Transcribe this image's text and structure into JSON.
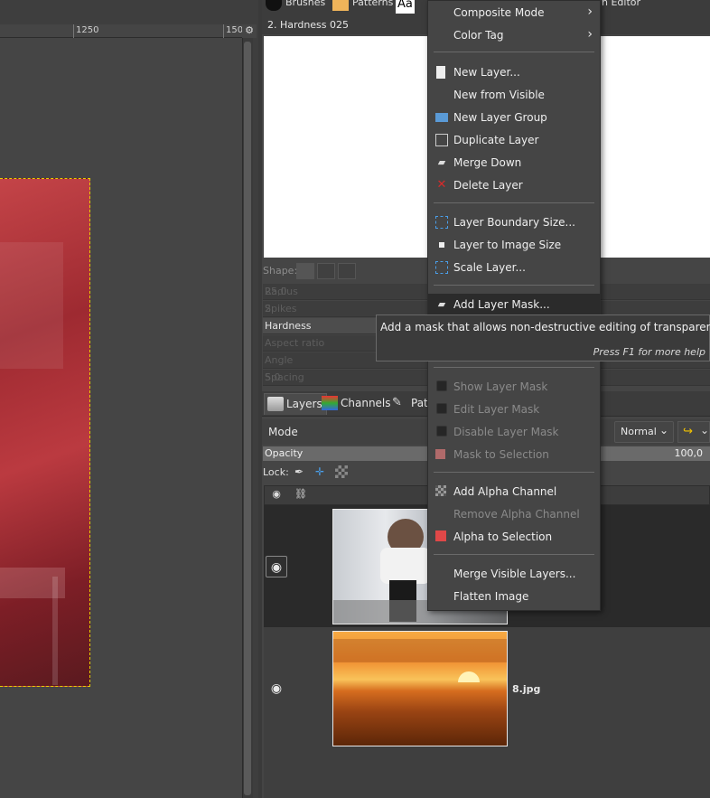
{
  "canvas": {
    "ruler_labels": [
      "1250",
      "150"
    ]
  },
  "top_tabs": {
    "brushes": "Brushes",
    "patterns": "Patterns",
    "fonts_icon_text": "Aa",
    "editor": "n Editor"
  },
  "brush_panel": {
    "title": "2. Hardness 025",
    "shape_label": "Shape:",
    "params": [
      {
        "label": "Radius",
        "value": "25,0"
      },
      {
        "label": "Spikes",
        "value": "2"
      },
      {
        "label": "Hardness",
        "value": ""
      },
      {
        "label": "Aspect ratio",
        "value": ""
      },
      {
        "label": "Angle",
        "value": ""
      },
      {
        "label": "Spacing",
        "value": "5,0"
      }
    ]
  },
  "dock": {
    "tabs": [
      {
        "label": "Layers",
        "icon": "layers-icon"
      },
      {
        "label": "Channels",
        "icon": "channels-icon"
      },
      {
        "label": "Path",
        "icon": "paths-icon"
      }
    ],
    "mode_label": "Mode",
    "mode_value": "Normal",
    "opacity_label": "Opacity",
    "opacity_value": "100,0",
    "lock_label": "Lock:",
    "layers": [
      {
        "name": "",
        "visible": true,
        "selected": true
      },
      {
        "name": "8.jpg",
        "visible": true,
        "selected": false
      }
    ]
  },
  "context_menu": {
    "items": [
      {
        "label": "Composite Mode",
        "submenu": true,
        "icon": ""
      },
      {
        "label": "Color Tag",
        "submenu": true,
        "icon": ""
      },
      {
        "label": "New Layer...",
        "icon": "new-layer-icon"
      },
      {
        "label": "New from Visible",
        "icon": ""
      },
      {
        "label": "New Layer Group",
        "icon": "folder-icon"
      },
      {
        "label": "Duplicate Layer",
        "icon": "duplicate-icon"
      },
      {
        "label": "Merge Down",
        "icon": "merge-down-icon"
      },
      {
        "label": "Delete Layer",
        "icon": "delete-icon"
      },
      {
        "label": "Layer Boundary Size...",
        "icon": "boundary-size-icon"
      },
      {
        "label": "Layer to Image Size",
        "icon": "layer-to-image-icon"
      },
      {
        "label": "Scale Layer...",
        "icon": "scale-layer-icon"
      },
      {
        "label": "Add Layer Mask...",
        "icon": "add-mask-icon",
        "highlighted": true
      },
      {
        "label": "Show Layer Mask",
        "disabled": true,
        "checkbox": true
      },
      {
        "label": "Edit Layer Mask",
        "disabled": true,
        "checkbox": true
      },
      {
        "label": "Disable Layer Mask",
        "disabled": true,
        "checkbox": true
      },
      {
        "label": "Mask to Selection",
        "disabled": true,
        "icon": "mask-selection-icon"
      },
      {
        "label": "Add Alpha Channel",
        "icon": "alpha-channel-icon"
      },
      {
        "label": "Remove Alpha Channel",
        "disabled": true,
        "icon": ""
      },
      {
        "label": "Alpha to Selection",
        "icon": "alpha-selection-icon"
      },
      {
        "label": "Merge Visible Layers...",
        "icon": ""
      },
      {
        "label": "Flatten Image",
        "icon": ""
      }
    ]
  },
  "tooltip": {
    "text": "Add a mask that allows non-destructive editing of transparency",
    "help": "Press F1 for more help"
  },
  "colors": {
    "menu_bg": "#454545",
    "highlight": "#2b2b2b",
    "delete_red": "#d62b2b",
    "selection_marquee": "#e6d000"
  }
}
